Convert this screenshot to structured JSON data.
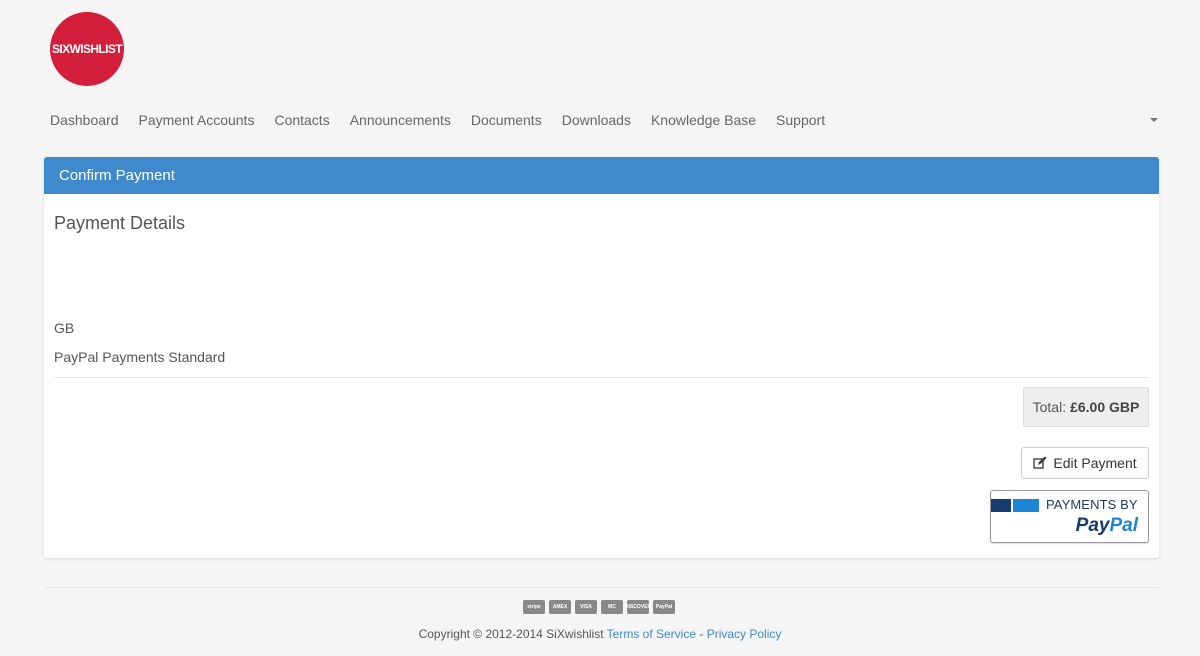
{
  "logo": {
    "text": "SIXWISHLIST"
  },
  "nav": {
    "items": [
      "Dashboard",
      "Payment Accounts",
      "Contacts",
      "Announcements",
      "Documents",
      "Downloads",
      "Knowledge Base",
      "Support"
    ]
  },
  "panel": {
    "title": "Confirm Payment",
    "section_title": "Payment Details",
    "country": "GB",
    "method": "PayPal Payments Standard",
    "total_label": "Total:",
    "total_value": "£6.00 GBP",
    "edit_label": "Edit Payment",
    "paypal_top": "PAYMENTS BY",
    "paypal_pay": "Pay",
    "paypal_pal": "Pal"
  },
  "footer": {
    "cards": [
      "stripe",
      "AMEX",
      "VISA",
      "MC",
      "DISCOVER",
      "PayPal"
    ],
    "copyright": "Copyright © 2012-2014 SiXwishlist",
    "terms": "Terms of Service",
    "separator": "-",
    "privacy": "Privacy Policy"
  },
  "colors": {
    "brand": "#d41f3c",
    "panel_header": "#3e8acc",
    "link": "#3e8acc"
  },
  "icons": {
    "edit": "edit-icon",
    "dropdown": "caret-down-icon"
  }
}
